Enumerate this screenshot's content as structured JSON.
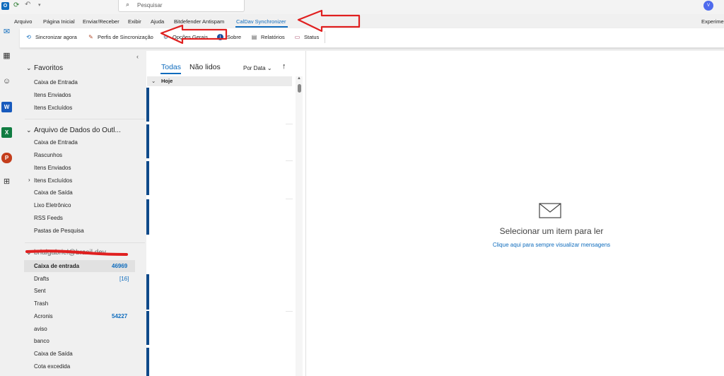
{
  "titlebar": {
    "search_placeholder": "Pesquisar",
    "avatar_initial": "V"
  },
  "menu": {
    "items": [
      "Arquivo",
      "Página Inicial",
      "Enviar/Receber",
      "Exibir",
      "Ajuda",
      "Bitdefender Antispam",
      "CalDav Synchronizer"
    ],
    "right_label": "Experime"
  },
  "ribbon": {
    "sync_now": "Sincronizar agora",
    "profiles": "Perfis de Sincronização",
    "general_options": "Opções Gerais",
    "about": "Sobre",
    "reports": "Relatórios",
    "status": "Status"
  },
  "folders": {
    "favorites": {
      "title": "Favoritos",
      "items": [
        "Caixa de Entrada",
        "Itens Enviados",
        "Itens Excluídos"
      ]
    },
    "datafile": {
      "title": "Arquivo de Dados do Outl...",
      "items": [
        "Caixa de Entrada",
        "Rascunhos",
        "Itens Enviados",
        "Itens Excluídos",
        "Caixa de Saída",
        "Lixo Eletrônico",
        "RSS Feeds",
        "Pastas de Pesquisa"
      ]
    },
    "account": {
      "title": "brialgabriel@brasil.dev",
      "items": [
        {
          "label": "Caixa de entrada",
          "count": "46969"
        },
        {
          "label": "Drafts",
          "count": "[16]"
        },
        {
          "label": "Sent",
          "count": ""
        },
        {
          "label": "Trash",
          "count": ""
        },
        {
          "label": "Acronis",
          "count": "54227"
        },
        {
          "label": "aviso",
          "count": ""
        },
        {
          "label": "banco",
          "count": ""
        },
        {
          "label": "Caixa de Saída",
          "count": ""
        },
        {
          "label": "Cota excedida",
          "count": ""
        }
      ]
    }
  },
  "messagelist": {
    "tab_all": "Todas",
    "tab_unread": "Não lidos",
    "sort_label": "Por Data",
    "group_today": "Hoje"
  },
  "reading": {
    "empty_title": "Selecionar um item para ler",
    "empty_link": "Clique aqui para sempre visualizar mensagens"
  },
  "colors": {
    "accent": "#0f6cbd",
    "annotation_red": "#e02020"
  },
  "icons": [
    "outlook-icon",
    "sync-icon",
    "undo-icon",
    "mail-icon",
    "calendar-icon",
    "people-icon",
    "word-icon",
    "excel-icon",
    "powerpoint-icon",
    "apps-icon",
    "search-icon",
    "envelope-icon"
  ]
}
